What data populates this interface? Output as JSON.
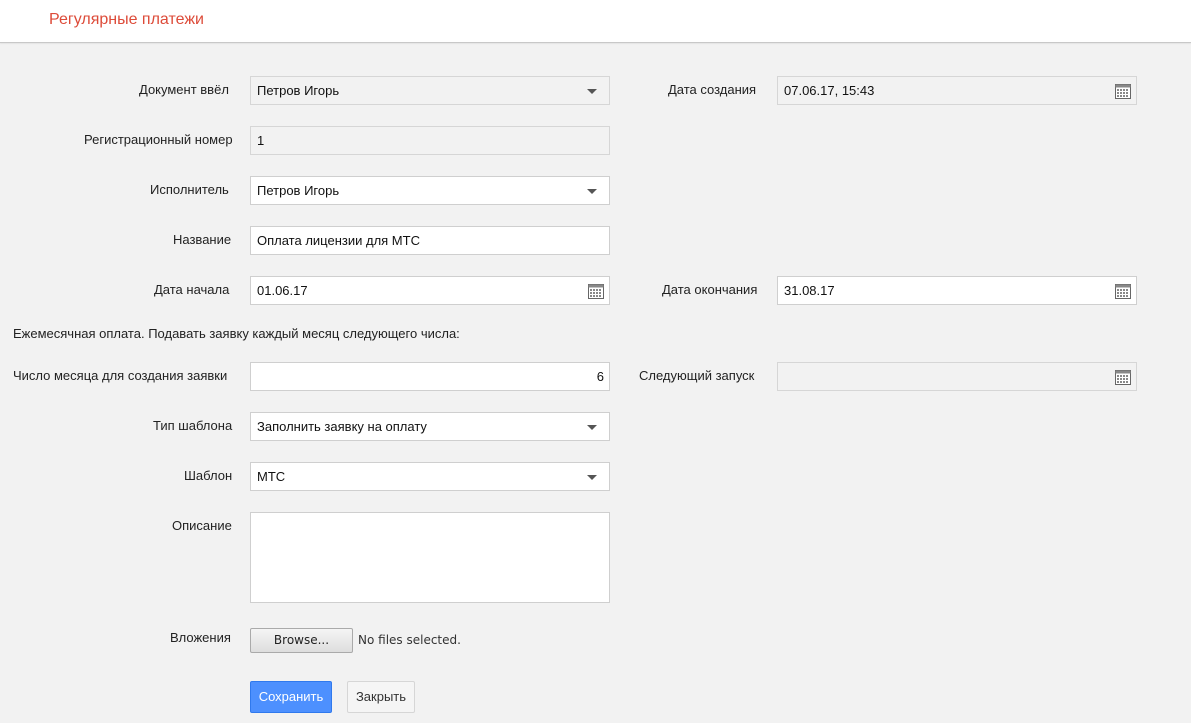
{
  "header": {
    "title": "Регулярные платежи",
    "title_color": "#dd4b39"
  },
  "form": {
    "author": {
      "label": "Документ ввёл",
      "value": "Петров Игорь"
    },
    "created": {
      "label": "Дата создания",
      "value": "07.06.17, 15:43"
    },
    "reg_number": {
      "label": "Регистрационный номер",
      "value": "1"
    },
    "executor": {
      "label": "Исполнитель",
      "value": "Петров Игорь"
    },
    "name": {
      "label": "Название",
      "value": "Оплата лицензии для МТС"
    },
    "start_date": {
      "label": "Дата начала",
      "value": "01.06.17"
    },
    "end_date": {
      "label": "Дата окончания",
      "value": "31.08.17"
    },
    "monthly_note": "Ежемесячная оплата. Подавать заявку каждый месяц следующего числа:",
    "day_of_month": {
      "label": "Число месяца для создания заявки",
      "value": "6"
    },
    "next_run": {
      "label": "Следующий запуск",
      "value": ""
    },
    "template_type": {
      "label": "Тип шаблона",
      "value": "Заполнить заявку на оплату"
    },
    "template": {
      "label": "Шаблон",
      "value": "МТС"
    },
    "description": {
      "label": "Описание",
      "value": ""
    },
    "attachments": {
      "label": "Вложения",
      "browse_label": "Browse...",
      "status": "No files selected."
    }
  },
  "actions": {
    "save_label": "Сохранить",
    "close_label": "Закрыть",
    "save_color": "#4d90fe"
  },
  "icons": {
    "dropdown": "chevron-down-icon",
    "calendar": "calendar-icon"
  }
}
